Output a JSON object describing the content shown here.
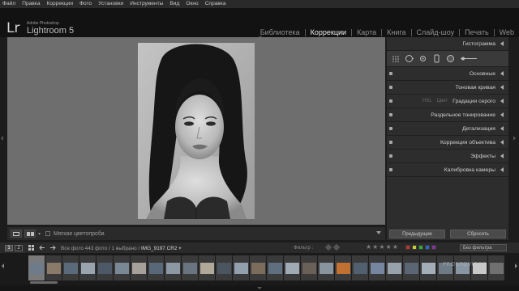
{
  "menu": [
    "Файл",
    "Правка",
    "Коррекции",
    "Фото",
    "Установки",
    "Инструменты",
    "Вид",
    "Окно",
    "Справка"
  ],
  "identity": {
    "mark": "Lr",
    "brand_small": "Adobe Photoshop",
    "product": "Lightroom 5"
  },
  "modules": [
    {
      "label": "Библиотека",
      "active": false
    },
    {
      "label": "Коррекции",
      "active": true
    },
    {
      "label": "Карта",
      "active": false
    },
    {
      "label": "Книга",
      "active": false
    },
    {
      "label": "Слайд-шоу",
      "active": false
    },
    {
      "label": "Печать",
      "active": false
    },
    {
      "label": "Web",
      "active": false
    }
  ],
  "toolbar": {
    "soft_proof_label": "Мягкая цветопроба"
  },
  "right_panel": {
    "histogram": "Гистограмма",
    "sections": [
      {
        "label": "Основные"
      },
      {
        "label": "Тоновая кривая"
      },
      {
        "hsl": "HSL",
        "color": "Цвет",
        "label": "Градации серого"
      },
      {
        "label": "Раздельное тонирование"
      },
      {
        "label": "Детализация"
      },
      {
        "label": "Коррекция объектива"
      },
      {
        "label": "Эффекты"
      },
      {
        "label": "Калибровка камеры"
      }
    ],
    "previous_button": "Предыдущие",
    "reset_button": "Сбросить"
  },
  "filmstrip_bar": {
    "monitor_1": "1",
    "monitor_2": "2",
    "source_label": "Все фото",
    "count": "443 фото",
    "selected": "1 выбрано",
    "filename": "IMG_9197.CR2",
    "filter_label": "Фильтр :",
    "filter_value": "Без фильтра"
  },
  "watermark": "PROSTOVIDEO",
  "colors": {
    "accent": "#ededed",
    "canvas": "#6e6e6e",
    "panel": "#2d2d2d"
  }
}
